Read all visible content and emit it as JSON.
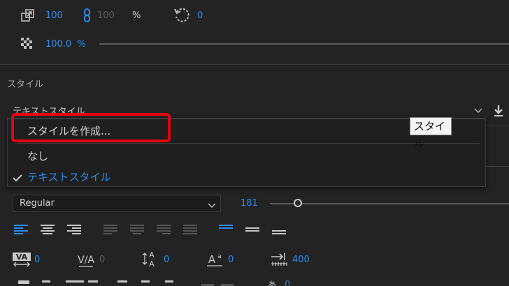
{
  "scale": {
    "value": "100",
    "linked_value": "100",
    "unit": "%",
    "rotation": "0"
  },
  "opacity": {
    "value": "100.0",
    "unit": "%"
  },
  "section_label": "スタイル",
  "style_dropdown": {
    "selected": "テキストスタイル"
  },
  "menu": {
    "create_label": "スタイルを作成...",
    "items": [
      {
        "label": "なし",
        "checked": false
      },
      {
        "label": "テキストスタイル",
        "checked": true
      }
    ]
  },
  "tooltip": "スタイル",
  "font": {
    "style": "Regular",
    "size": "181"
  },
  "metrics": {
    "kerning": "0",
    "tracking": "0",
    "leading": "0",
    "baseline": "0",
    "tab_width": "400",
    "tsume": "0"
  },
  "colors": {
    "accent": "#2d8ceb",
    "highlight": "#e50012",
    "background": "#232323"
  }
}
